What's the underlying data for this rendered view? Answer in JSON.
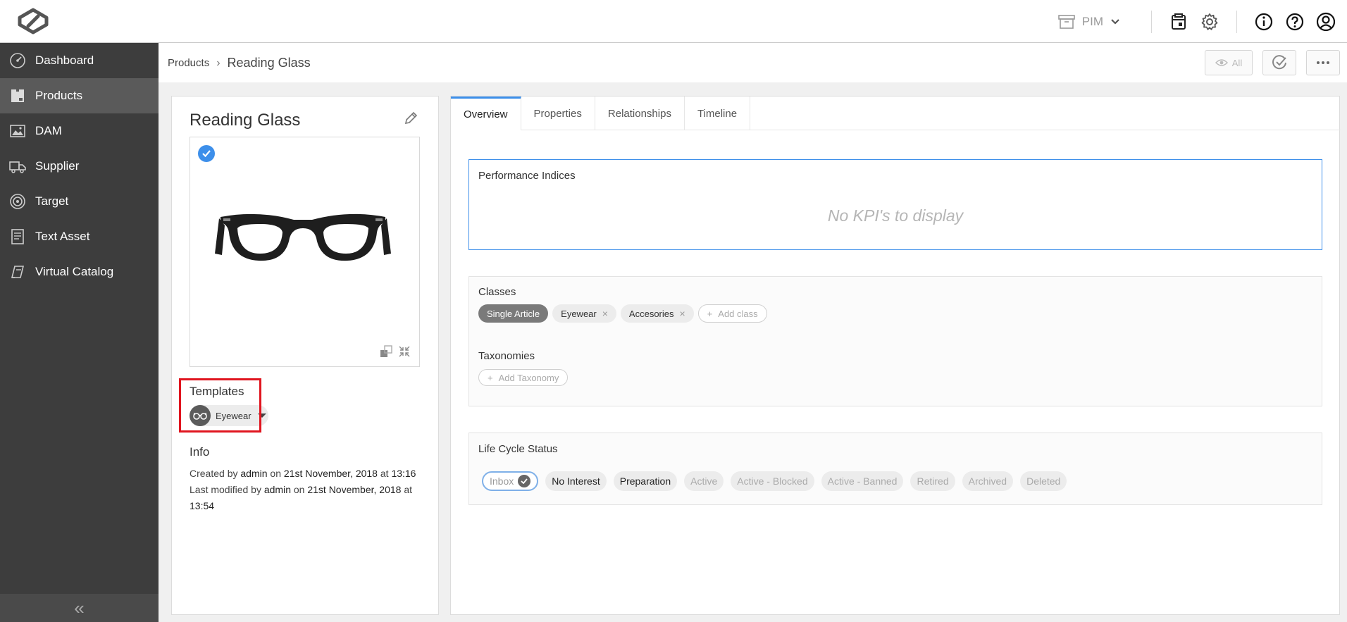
{
  "topbar": {
    "module_label": "PIM",
    "icons": [
      "cube-logo-icon",
      "archive-box-icon",
      "chevron-down-icon",
      "clipboard-calendar-icon",
      "gear-icon",
      "info-icon",
      "help-icon",
      "user-icon"
    ]
  },
  "sidebar": {
    "items": [
      {
        "label": "Dashboard",
        "icon": "gauge-icon"
      },
      {
        "label": "Products",
        "icon": "package-icon"
      },
      {
        "label": "DAM",
        "icon": "image-icon"
      },
      {
        "label": "Supplier",
        "icon": "truck-icon"
      },
      {
        "label": "Target",
        "icon": "target-icon"
      },
      {
        "label": "Text Asset",
        "icon": "document-icon"
      },
      {
        "label": "Virtual Catalog",
        "icon": "book-icon"
      }
    ],
    "active_index": 1,
    "collapse_label": "«"
  },
  "breadcrumb": {
    "parent": "Products",
    "separator": "›",
    "current": "Reading Glass",
    "view_all_label": "All"
  },
  "product": {
    "title": "Reading Glass",
    "templates_label": "Templates",
    "template_name": "Eyewear",
    "info_label": "Info",
    "created_prefix": "Created by",
    "created_by": "admin",
    "created_on_word": "on",
    "created_date": "21st November, 2018",
    "created_at_word": "at",
    "created_time": "13:16",
    "modified_prefix": "Last modified by",
    "modified_by": "admin",
    "modified_on_word": "on",
    "modified_date": "21st November, 2018",
    "modified_at_word": "at",
    "modified_time": "13:54"
  },
  "tabs": [
    "Overview",
    "Properties",
    "Relationships",
    "Timeline"
  ],
  "active_tab": 0,
  "performance": {
    "title": "Performance Indices",
    "empty_text": "No KPI's to display"
  },
  "classes": {
    "title": "Classes",
    "items": [
      "Single Article",
      "Eyewear",
      "Accesories"
    ],
    "add_label": "Add class",
    "taxonomies_title": "Taxonomies",
    "add_taxonomy_label": "Add Taxonomy"
  },
  "lifecycle": {
    "title": "Life Cycle Status",
    "statuses": [
      "Inbox",
      "No Interest",
      "Preparation",
      "Active",
      "Active - Blocked",
      "Active - Banned",
      "Retired",
      "Archived",
      "Deleted"
    ]
  },
  "colors": {
    "accent": "#3d8fea",
    "sidebar_bg": "#3d3d3d",
    "highlight": "#e0151f"
  }
}
